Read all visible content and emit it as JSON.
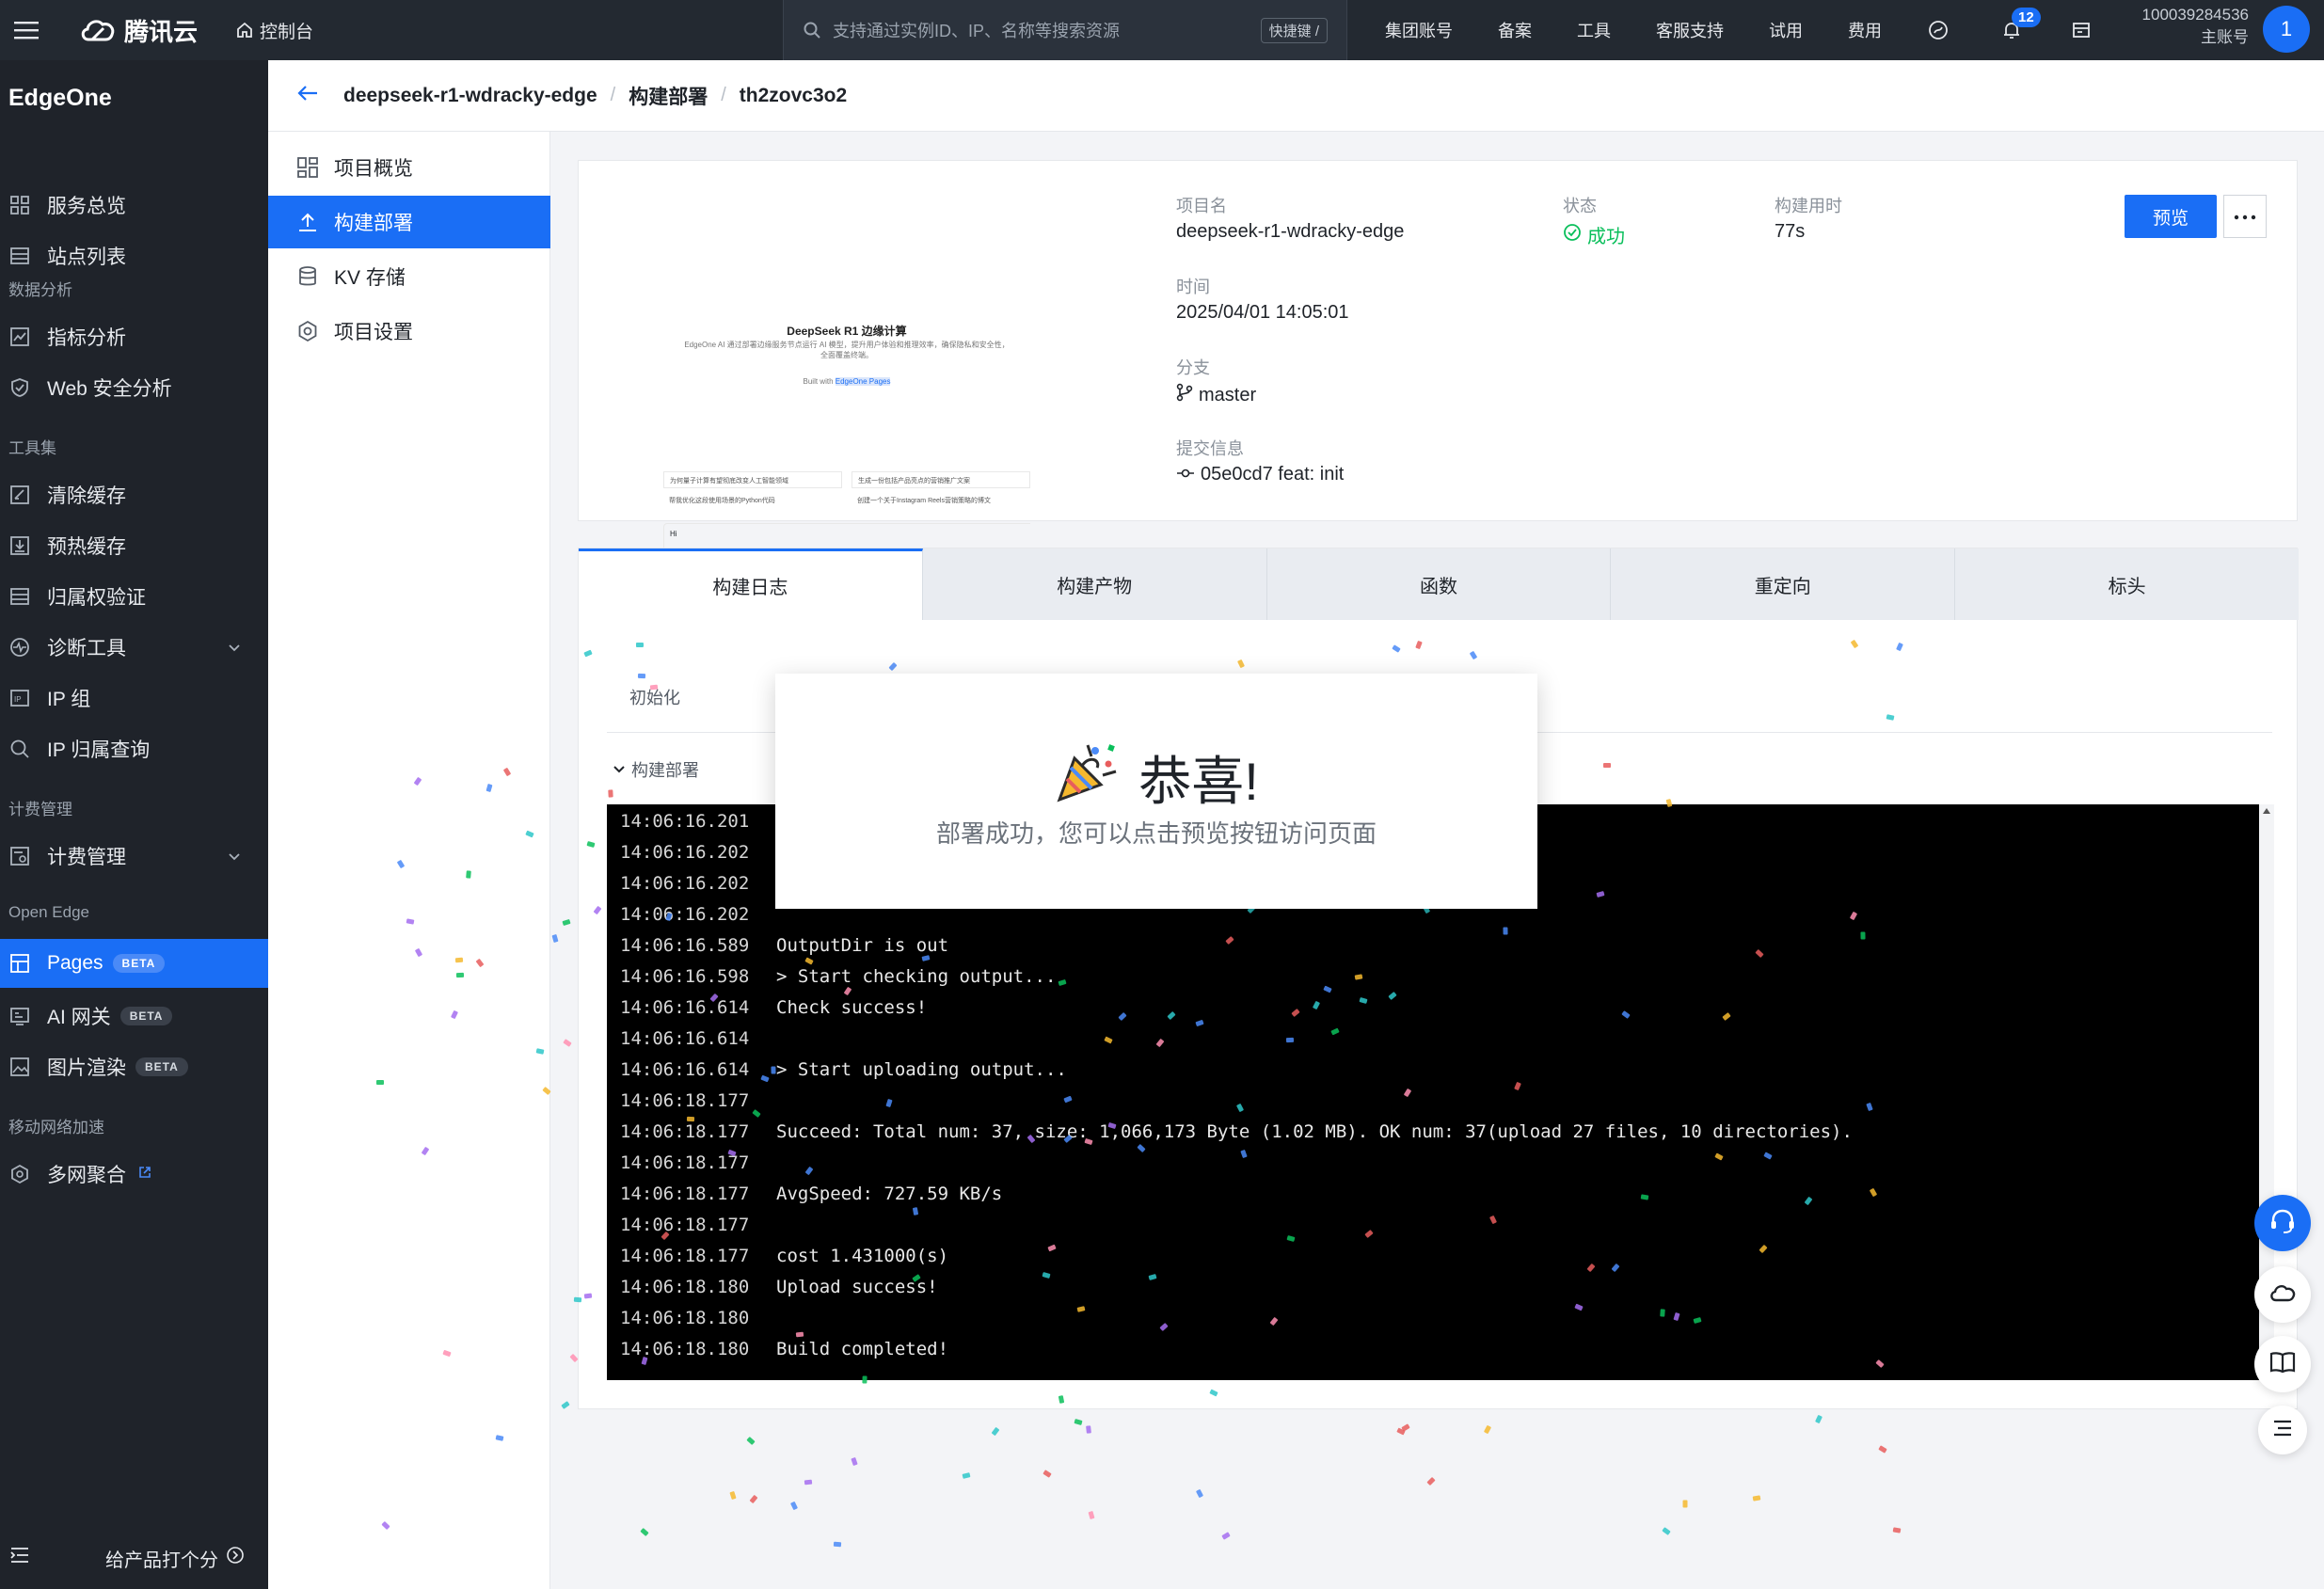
{
  "topbar": {
    "brand": "腾讯云",
    "console": "控制台",
    "search_placeholder": "支持通过实例ID、IP、名称等搜索资源",
    "shortcut": "快捷键 /",
    "links": [
      "集团账号",
      "备案",
      "工具",
      "客服支持",
      "试用",
      "费用"
    ],
    "notification_count": "12",
    "account_id": "100039284536",
    "account_role": "主账号",
    "avatar": "1"
  },
  "sidebar": {
    "product": "EdgeOne",
    "items": [
      {
        "label": "服务总览",
        "icon": "dashboard-icon"
      },
      {
        "label": "站点列表",
        "icon": "list-icon"
      },
      {
        "group": "数据分析"
      },
      {
        "label": "指标分析",
        "icon": "chart-icon"
      },
      {
        "label": "Web 安全分析",
        "icon": "shield-icon"
      },
      {
        "group": "工具集"
      },
      {
        "label": "清除缓存",
        "icon": "clear-cache-icon"
      },
      {
        "label": "预热缓存",
        "icon": "prefetch-icon"
      },
      {
        "label": "归属权验证",
        "icon": "verify-icon"
      },
      {
        "label": "诊断工具",
        "icon": "diagnose-icon"
      },
      {
        "label": "IP 组",
        "icon": "ip-group-icon"
      },
      {
        "label": "IP 归属查询",
        "icon": "search-icon"
      },
      {
        "group": "计费管理"
      },
      {
        "label": "计费管理",
        "icon": "billing-icon"
      },
      {
        "group": "Open Edge"
      },
      {
        "label": "Pages",
        "icon": "pages-icon",
        "beta": "BETA"
      },
      {
        "label": "AI 网关",
        "icon": "ai-gateway-icon",
        "beta": "BETA"
      },
      {
        "label": "图片渲染",
        "icon": "image-icon",
        "beta": "BETA"
      },
      {
        "group": "移动网络加速"
      },
      {
        "label": "多网聚合",
        "icon": "multi-network-icon"
      }
    ],
    "feedback": "给产品打个分"
  },
  "breadcrumb": {
    "project": "deepseek-r1-wdracky-edge",
    "section": "构建部署",
    "deployment": "th2zovc3o2"
  },
  "submenu": [
    "项目概览",
    "构建部署",
    "KV 存储",
    "项目设置"
  ],
  "project": {
    "thumb_title": "DeepSeek R1 边缘计算",
    "thumb_subtitle": "EdgeOne AI 通过部署边缘服务节点运行 AI 模型，提升用户体验和推理效率，确保隐私和安全性，全面覆盖终端。",
    "thumb_btn_prefix": "Built with",
    "thumb_btn": "EdgeOne Pages",
    "thumb_rows": [
      "为何量子计算有望彻底改变人工智能领域",
      "生成一份包括产品亮点的营销推广文案",
      "帮我优化这段使用场景的Python代码",
      "创建一个关于Instagram Reels营销策略的博文"
    ],
    "thumb_input": "Hi",
    "name_label": "项目名",
    "name": "deepseek-r1-wdracky-edge",
    "status_label": "状态",
    "status": "成功",
    "duration_label": "构建用时",
    "duration": "77s",
    "time_label": "时间",
    "time": "2025/04/01 14:05:01",
    "branch_label": "分支",
    "branch": "master",
    "commit_label": "提交信息",
    "commit": "05e0cd7 feat: init",
    "preview_button": "预览"
  },
  "tabs": [
    "构建日志",
    "构建产物",
    "函数",
    "重定向",
    "标头"
  ],
  "steps": {
    "init": "初始化",
    "build": "构建部署"
  },
  "log": [
    {
      "t": "14:06:16.201",
      "m": ""
    },
    {
      "t": "14:06:16.202",
      "m": ""
    },
    {
      "t": "14:06:16.202",
      "m": ""
    },
    {
      "t": "14:06:16.202",
      "m": ""
    },
    {
      "t": "14:06:16.589",
      "m": "OutputDir is out"
    },
    {
      "t": "14:06:16.598",
      "m": "> Start checking output..."
    },
    {
      "t": "14:06:16.614",
      "m": "Check success!"
    },
    {
      "t": "14:06:16.614",
      "m": ""
    },
    {
      "t": "14:06:16.614",
      "m": "> Start uploading output..."
    },
    {
      "t": "14:06:18.177",
      "m": ""
    },
    {
      "t": "14:06:18.177",
      "m": "Succeed: Total num: 37, size: 1,066,173 Byte (1.02 MB). OK num: 37(upload 27 files, 10 directories)."
    },
    {
      "t": "14:06:18.177",
      "m": ""
    },
    {
      "t": "14:06:18.177",
      "m": "AvgSpeed: 727.59 KB/s"
    },
    {
      "t": "14:06:18.177",
      "m": ""
    },
    {
      "t": "14:06:18.177",
      "m": "cost 1.431000(s)"
    },
    {
      "t": "14:06:18.180",
      "m": "Upload success!"
    },
    {
      "t": "14:06:18.180",
      "m": ""
    },
    {
      "t": "14:06:18.180",
      "m": "Build completed!"
    }
  ],
  "modal": {
    "title": "恭喜!",
    "subtitle": "部署成功，您可以点击预览按钮访问页面"
  },
  "colors": {
    "accent": "#1a6ef5",
    "success": "#0abf5b",
    "sidebar": "#1f232a",
    "topbar": "#232931"
  }
}
